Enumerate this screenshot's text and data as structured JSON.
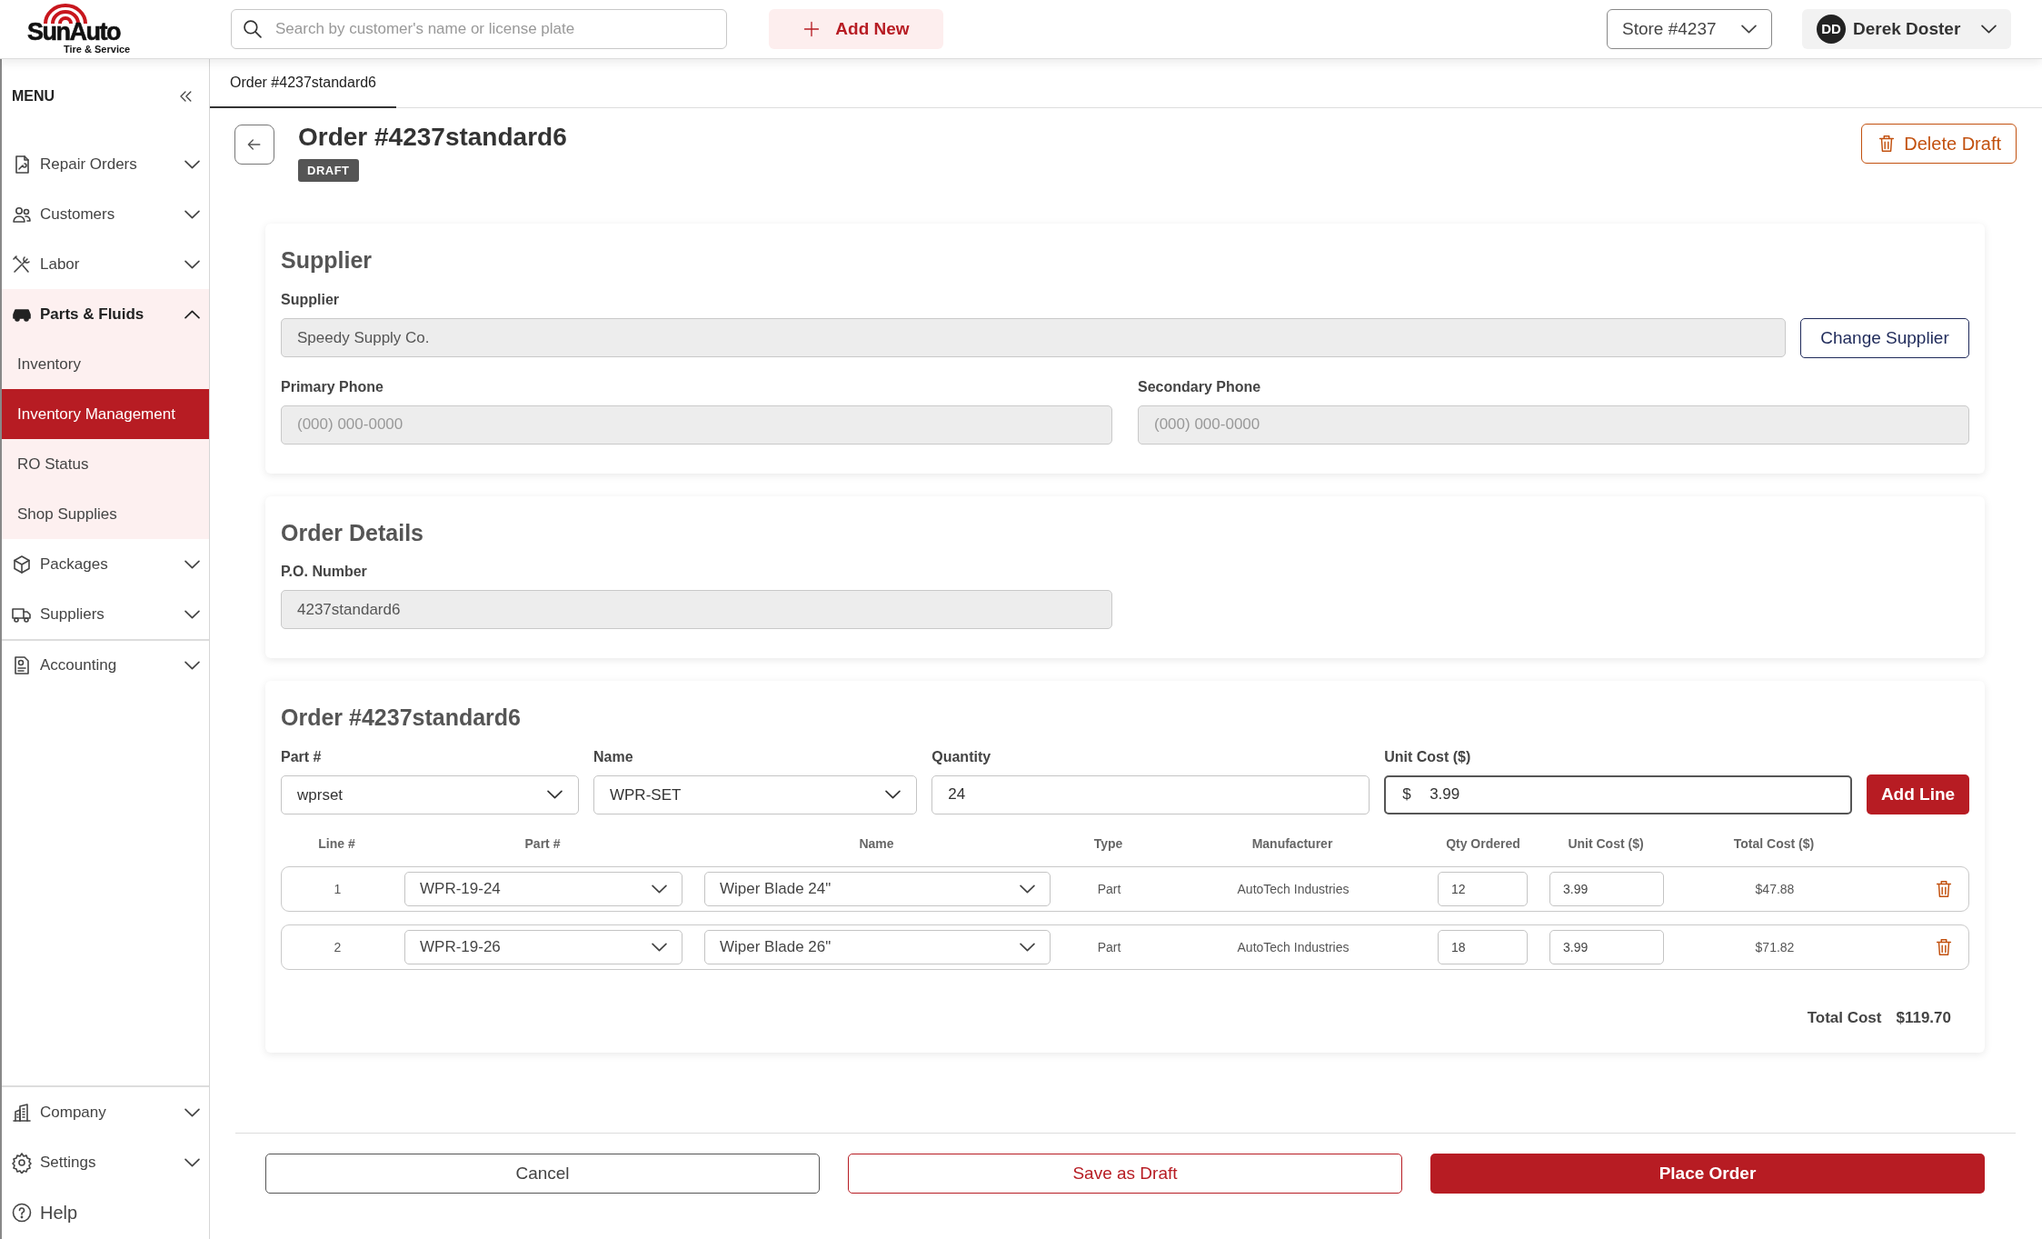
{
  "header": {
    "logo": {
      "name": "SunAuto",
      "tagline": "Tire & Service"
    },
    "search": {
      "placeholder": "Search by customer's name or license plate"
    },
    "add_new": "Add New",
    "store": "Store #4237",
    "user": {
      "initials": "DD",
      "name": "Derek Doster"
    }
  },
  "sidebar": {
    "title": "MENU",
    "items": [
      {
        "label": "Repair Orders",
        "expanded": false
      },
      {
        "label": "Customers",
        "expanded": false
      },
      {
        "label": "Labor",
        "expanded": false
      },
      {
        "label": "Parts & Fluids",
        "expanded": true,
        "children": [
          {
            "label": "Inventory",
            "selected": false
          },
          {
            "label": "Inventory Management",
            "selected": true
          },
          {
            "label": "RO Status",
            "selected": false
          },
          {
            "label": "Shop Supplies",
            "selected": false
          }
        ]
      },
      {
        "label": "Packages",
        "expanded": false
      },
      {
        "label": "Suppliers",
        "expanded": false
      },
      {
        "label": "Accounting",
        "expanded": false
      }
    ],
    "bottom_items": [
      {
        "kind": "group",
        "label": "Company",
        "expanded": false
      },
      {
        "kind": "group",
        "label": "Settings",
        "expanded": false
      },
      {
        "kind": "link",
        "label": "Help"
      }
    ]
  },
  "tabs": [
    {
      "label": "Order #4237standard6",
      "selected": true
    }
  ],
  "page": {
    "title": "Order #4237standard6",
    "status": "DRAFT",
    "delete_button": "Delete Draft"
  },
  "supplier": {
    "title": "Supplier",
    "supplier_label": "Supplier",
    "supplier_value": "Speedy Supply Co.",
    "change_button": "Change Supplier",
    "primary_phone": {
      "label": "Primary Phone",
      "placeholder": "(000) 000-0000"
    },
    "secondary_phone": {
      "label": "Secondary Phone",
      "placeholder": "(000) 000-0000"
    }
  },
  "order_details": {
    "title": "Order Details",
    "po_label": "P.O. Number",
    "po_value": "4237standard6"
  },
  "order_lines": {
    "title": "Order #4237standard6",
    "entry": [
      {
        "kind": "select",
        "label": "Part #",
        "value": "wprset",
        "focused": false
      },
      {
        "kind": "select",
        "label": "Name",
        "value": "WPR-SET",
        "focused": false
      },
      {
        "kind": "text",
        "label": "Quantity",
        "value": "24",
        "focused": false
      },
      {
        "kind": "money",
        "label": "Unit Cost ($)",
        "prefix": "$",
        "value": "3.99",
        "focused": true
      }
    ],
    "add_button": "Add Line",
    "columns": [
      "Line #",
      "Part #",
      "Name",
      "Type",
      "Manufacturer",
      "Qty Ordered",
      "Unit Cost ($)",
      "Total Cost ($)"
    ],
    "rows": [
      {
        "line": "1",
        "part": "WPR-19-24",
        "name": "Wiper Blade 24\"",
        "type": "Part",
        "manufacturer": "AutoTech Industries",
        "qty": "12",
        "unit_cost": "3.99",
        "total": "$47.88"
      },
      {
        "line": "2",
        "part": "WPR-19-26",
        "name": "Wiper Blade 26\"",
        "type": "Part",
        "manufacturer": "AutoTech Industries",
        "qty": "18",
        "unit_cost": "3.99",
        "total": "$71.82"
      }
    ],
    "total_label": "Total Cost",
    "total_value": "$119.70"
  },
  "footer": {
    "cancel": "Cancel",
    "save_draft": "Save as Draft",
    "place_order": "Place Order"
  }
}
